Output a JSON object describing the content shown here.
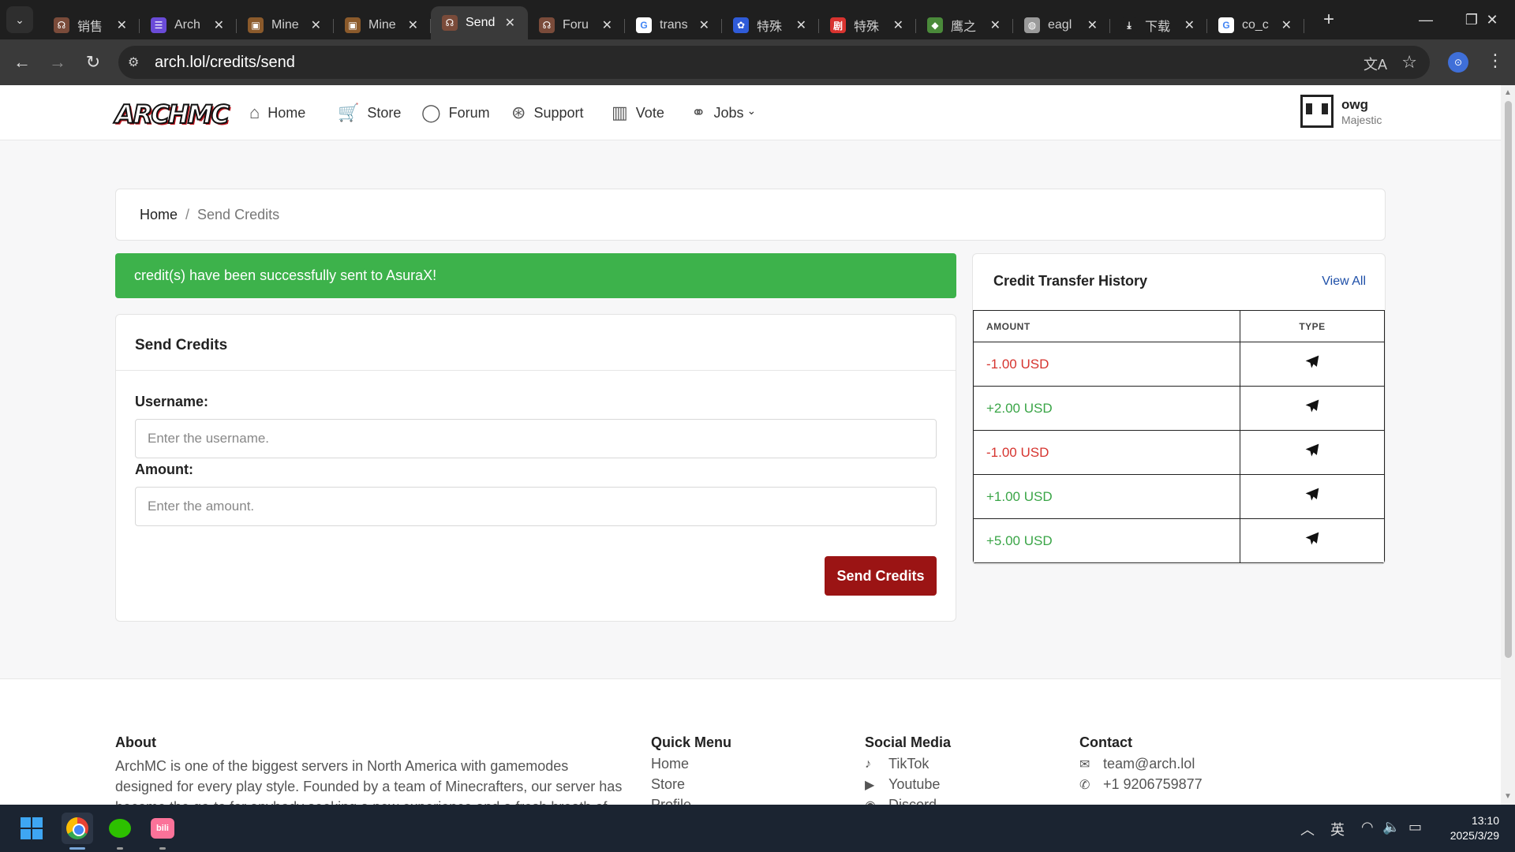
{
  "browser": {
    "tabs": [
      {
        "title": "销售",
        "fav_color": "#7a4b3a",
        "fav_glyph": "☊"
      },
      {
        "title": "Arch",
        "fav_color": "#6a4bd8",
        "fav_glyph": "☰"
      },
      {
        "title": "Mine",
        "fav_color": "#8b5a2b",
        "fav_glyph": "▣"
      },
      {
        "title": "Mine",
        "fav_color": "#8b5a2b",
        "fav_glyph": "▣"
      },
      {
        "title": "Send",
        "fav_color": "#7a4b3a",
        "fav_glyph": "☊",
        "active": true
      },
      {
        "title": "Foru",
        "fav_color": "#7a4b3a",
        "fav_glyph": "☊"
      },
      {
        "title": "trans",
        "fav_color": "#ffffff",
        "fav_glyph": "G"
      },
      {
        "title": "特殊",
        "fav_color": "#2f5bd8",
        "fav_glyph": "✿"
      },
      {
        "title": "特殊",
        "fav_color": "#d8332f",
        "fav_glyph": "剧"
      },
      {
        "title": "鹰之",
        "fav_color": "#4a8a3a",
        "fav_glyph": "◆"
      },
      {
        "title": "eagl",
        "fav_color": "#9a9a9a",
        "fav_glyph": "◍"
      },
      {
        "title": "下载",
        "fav_color": "#1f1f1f",
        "fav_glyph": "⤓"
      },
      {
        "title": "co_c",
        "fav_color": "#ffffff",
        "fav_glyph": "G"
      }
    ],
    "url": "arch.lol/credits/send",
    "profile_initial": "⊙"
  },
  "site": {
    "logo": "ARCHMC",
    "nav": [
      {
        "label": "Home",
        "icon": "home-icon",
        "glyph": "⌂"
      },
      {
        "label": "Store",
        "icon": "cart-icon",
        "glyph": "🛒"
      },
      {
        "label": "Forum",
        "icon": "chat-bubble-icon",
        "glyph": "◯"
      },
      {
        "label": "Support",
        "icon": "lifebuoy-icon",
        "glyph": "⊛"
      },
      {
        "label": "Vote",
        "icon": "bar-chart-icon",
        "glyph": "▥"
      },
      {
        "label": "Jobs",
        "icon": "link-icon",
        "glyph": "⚭",
        "dropdown": true
      }
    ],
    "user": {
      "name": "owg",
      "rank": "Majestic"
    }
  },
  "breadcrumb": {
    "home": "Home",
    "separator": "/",
    "current": "Send Credits"
  },
  "alert": {
    "text": "credit(s) have been successfully sent to AsuraX!",
    "color": "#3db24b"
  },
  "send_form": {
    "title": "Send Credits",
    "username_label": "Username:",
    "username_placeholder": "Enter the username.",
    "amount_label": "Amount:",
    "amount_placeholder": "Enter the amount.",
    "submit_label": "Send Credits",
    "submit_color": "#9b1414"
  },
  "history": {
    "title": "Credit Transfer History",
    "view_all": "View All",
    "col_amount": "AMOUNT",
    "col_type": "TYPE",
    "rows": [
      {
        "amount": "-1.00 USD",
        "sign": "neg",
        "type_icon": "paper-plane-icon"
      },
      {
        "amount": "+2.00 USD",
        "sign": "pos",
        "type_icon": "paper-plane-icon"
      },
      {
        "amount": "-1.00 USD",
        "sign": "neg",
        "type_icon": "paper-plane-icon"
      },
      {
        "amount": "+1.00 USD",
        "sign": "pos",
        "type_icon": "paper-plane-icon"
      },
      {
        "amount": "+5.00 USD",
        "sign": "pos",
        "type_icon": "paper-plane-icon"
      }
    ]
  },
  "footer": {
    "about": {
      "heading": "About",
      "text": "ArchMC is one of the biggest servers in North America with gamemodes designed for every play style. Founded by a team of Minecrafters, our server has become the go-to for anybody seeking a new experience and a fresh breath of gameplay."
    },
    "quick_menu": {
      "heading": "Quick Menu",
      "links": [
        "Home",
        "Store",
        "Profile"
      ]
    },
    "social": {
      "heading": "Social Media",
      "links": [
        {
          "label": "TikTok",
          "icon": "tiktok-icon",
          "glyph": "♪"
        },
        {
          "label": "Youtube",
          "icon": "youtube-icon",
          "glyph": "▶"
        },
        {
          "label": "Discord",
          "icon": "discord-icon",
          "glyph": "◉"
        }
      ]
    },
    "contact": {
      "heading": "Contact",
      "email": "team@arch.lol",
      "phone": "+1 9206759877"
    }
  },
  "taskbar": {
    "ime": "英",
    "time": "13:10",
    "date": "2025/3/29"
  }
}
